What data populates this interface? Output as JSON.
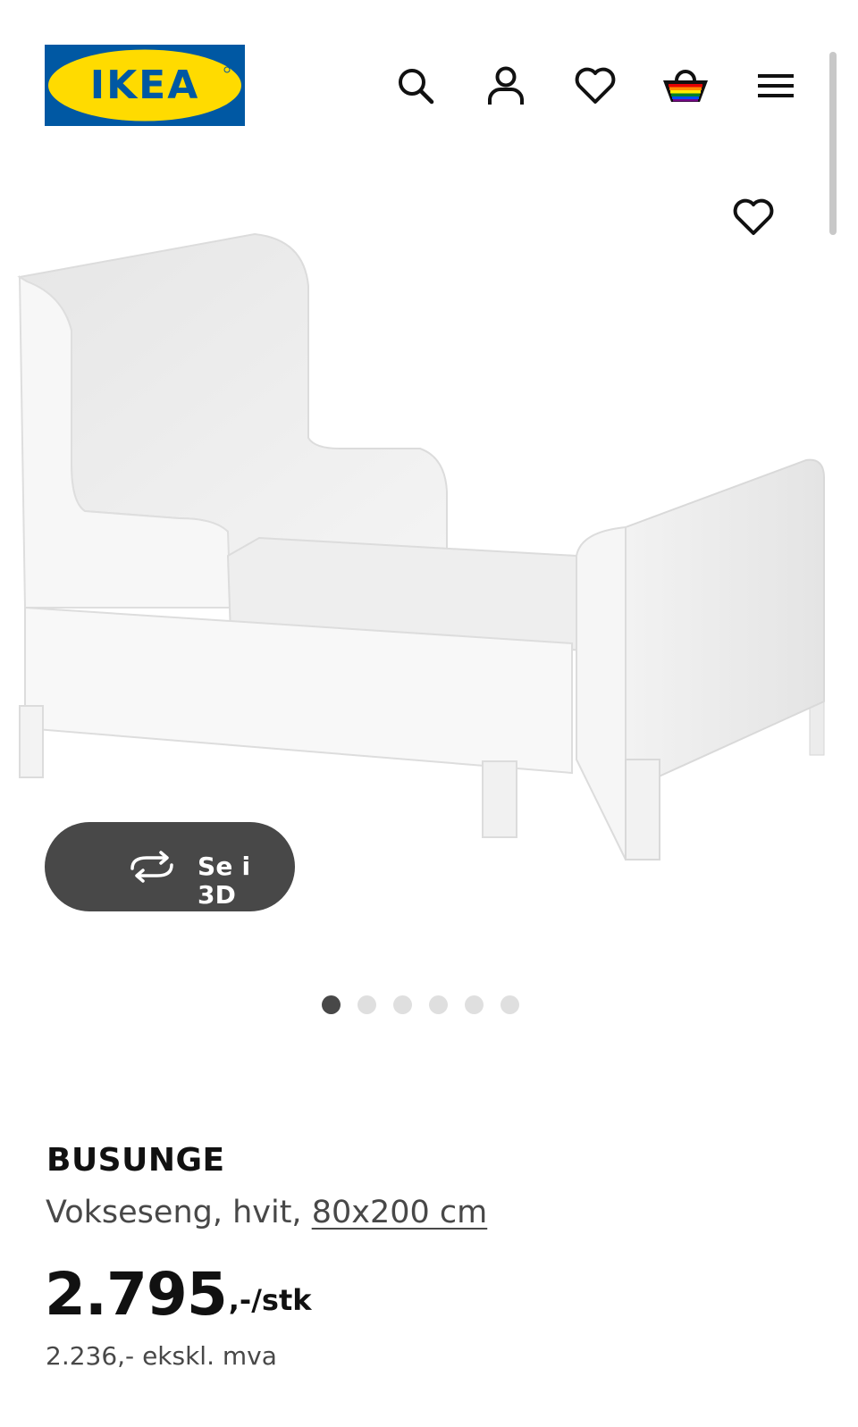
{
  "header": {
    "logo_text": "IKEA",
    "brand_colors": {
      "blue": "#0058a3",
      "yellow": "#ffdb00"
    },
    "icons": [
      "search-icon",
      "account-icon",
      "heart-icon",
      "shopping-basket-icon",
      "hamburger-menu-icon"
    ]
  },
  "gallery": {
    "wishlist_icon": "heart-icon",
    "view3d_label": "Se i 3D",
    "view3d_icon": "rotate-3d-icon",
    "dots_total": 6,
    "active_dot": 1
  },
  "product": {
    "name": "BUSUNGE",
    "description_prefix": "Vokseseng, hvit, ",
    "size_link": "80x200 cm",
    "price_integer": "2.795",
    "price_suffix": ",-/stk",
    "price_excl_vat": "2.236,- ekskl. mva"
  },
  "colors": {
    "text_primary": "#111111",
    "text_secondary": "#484848",
    "button_dark": "#484848",
    "dot_inactive": "#dfdfdf"
  }
}
